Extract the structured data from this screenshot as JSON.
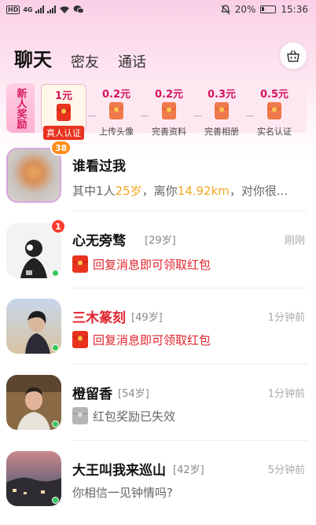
{
  "status_bar": {
    "hd_label": "HD",
    "network": "4G",
    "battery": "20%",
    "time": "15:36"
  },
  "tabs": [
    {
      "label": "聊天",
      "active": true
    },
    {
      "label": "密友",
      "active": false
    },
    {
      "label": "通话",
      "active": false
    }
  ],
  "reward_banner": {
    "tag": "新人奖励",
    "items": [
      {
        "amount": "1元",
        "label": "真人认证"
      },
      {
        "amount": "0.2元",
        "label": "上传头像"
      },
      {
        "amount": "0.2元",
        "label": "完善资料"
      },
      {
        "amount": "0.3元",
        "label": "完善相册"
      },
      {
        "amount": "0.5元",
        "label": "实名认证"
      }
    ]
  },
  "visitors": {
    "title": "谁看过我",
    "badge": "38",
    "desc_prefix": "其中1人",
    "desc_age": "25岁",
    "desc_mid": "，离你",
    "desc_dist": "14.92km",
    "desc_suffix": "，对你很..."
  },
  "chats": [
    {
      "name": "心无旁骛",
      "age": "[29岁]",
      "time": "刚刚",
      "message": "回复消息即可领取红包",
      "badge": "1",
      "name_red": false,
      "msg_type": "red-packet"
    },
    {
      "name": "三木篆刻",
      "age": "[49岁]",
      "time": "1分钟前",
      "message": "回复消息即可领取红包",
      "badge": "",
      "name_red": true,
      "msg_type": "red-packet"
    },
    {
      "name": "橙留香",
      "age": "[54岁]",
      "time": "1分钟前",
      "message": "红包奖励已失效",
      "badge": "",
      "name_red": false,
      "msg_type": "expired"
    },
    {
      "name": "大王叫我来巡山",
      "age": "[42岁]",
      "time": "5分钟前",
      "message": "你相信一见钟情吗?",
      "badge": "",
      "name_red": false,
      "msg_type": "text"
    }
  ],
  "colors": {
    "accent": "#e0252e",
    "highlight": "#f5a623",
    "online": "#35c759",
    "badge": "#ff3b30"
  }
}
